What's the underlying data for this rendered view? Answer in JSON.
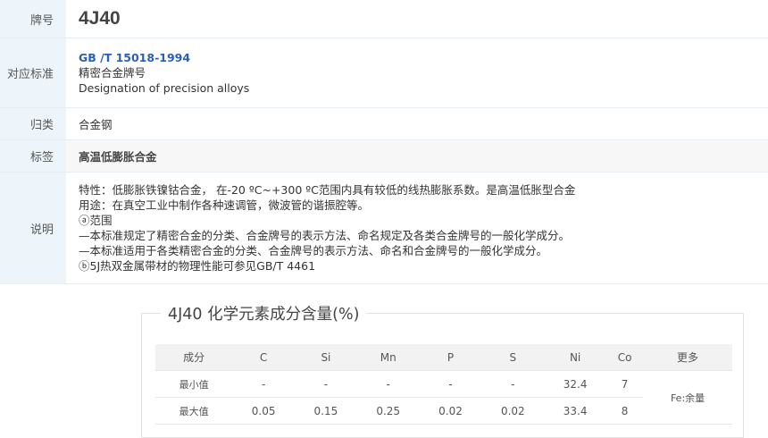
{
  "info": {
    "grade_label": "牌号",
    "grade_value": "4J40",
    "standard_label": "对应标准",
    "standard_code": "GB /T 15018-1994",
    "standard_name_cn": "精密合金牌号",
    "standard_name_en": "Designation of precision alloys",
    "category_label": "归类",
    "category_value": "合金钢",
    "tag_label": "标签",
    "tag_value": "高温低膨胀合金",
    "desc_label": "说明",
    "desc_lines": [
      "特性：低膨胀铁镍钴合金， 在-20 ºC~+300 ºC范围内具有较低的线热膨胀系数。是高温低胀型合金",
      "用途：在真空工业中制作各种速调管，微波管的谐振腔等。",
      "ⓐ范围",
      "—本标准规定了精密合金的分类、合金牌号的表示方法、命名规定及各类合金牌号的一般化学成分。",
      "—本标准适用于各类精密合金的分类、合金牌号的表示方法、命名和合金牌号的一般化学成分。",
      "ⓑ5J热双金属带材的物理性能可参见GB/T 4461"
    ]
  },
  "composition": {
    "title": "4J40 化学元素成分含量(%)",
    "headers": [
      "成分",
      "C",
      "Si",
      "Mn",
      "P",
      "S",
      "Ni",
      "Co",
      "更多"
    ],
    "min_row": {
      "label": "最小值",
      "values": [
        "-",
        "-",
        "-",
        "-",
        "-",
        "32.4",
        "7"
      ]
    },
    "max_row": {
      "label": "最大值",
      "values": [
        "0.05",
        "0.15",
        "0.25",
        "0.02",
        "0.02",
        "33.4",
        "8"
      ]
    },
    "more_value": "Fe:余量"
  }
}
